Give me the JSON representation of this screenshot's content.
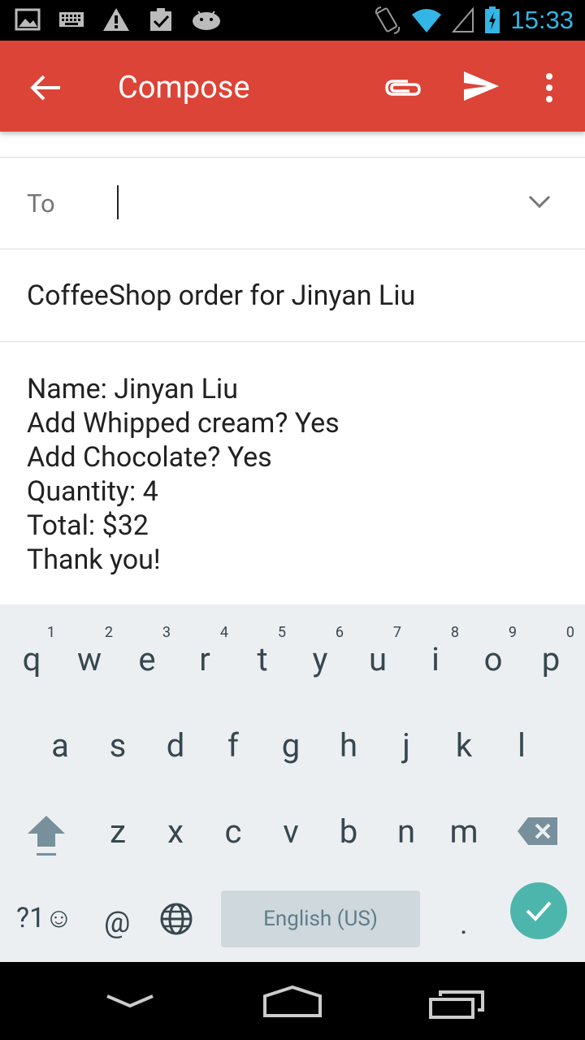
{
  "status_bar": {
    "time": "15:33",
    "left_icons": [
      "image-icon",
      "keyboard-icon",
      "warning-icon",
      "clipboard-check-icon",
      "android-icon"
    ],
    "right_icons": [
      "rotate-icon",
      "wifi-icon",
      "signal-icon",
      "battery-charging-icon"
    ]
  },
  "app_bar": {
    "title": "Compose",
    "color": "#db4437"
  },
  "compose": {
    "to_label": "To",
    "to_value": "",
    "subject": "CoffeeShop order for Jinyan Liu",
    "body_lines": [
      "Name: Jinyan Liu",
      "Add Whipped cream? Yes",
      "Add Chocolate? Yes",
      "Quantity: 4",
      "Total: $32",
      "Thank you!"
    ]
  },
  "keyboard": {
    "row1": [
      {
        "key": "q",
        "hint": "1"
      },
      {
        "key": "w",
        "hint": "2"
      },
      {
        "key": "e",
        "hint": "3"
      },
      {
        "key": "r",
        "hint": "4"
      },
      {
        "key": "t",
        "hint": "5"
      },
      {
        "key": "y",
        "hint": "6"
      },
      {
        "key": "u",
        "hint": "7"
      },
      {
        "key": "i",
        "hint": "8"
      },
      {
        "key": "o",
        "hint": "9"
      },
      {
        "key": "p",
        "hint": "0"
      }
    ],
    "row2": [
      "a",
      "s",
      "d",
      "f",
      "g",
      "h",
      "j",
      "k",
      "l"
    ],
    "row3": [
      "z",
      "x",
      "c",
      "v",
      "b",
      "n",
      "m"
    ],
    "symbols_label": "?1☺",
    "at_label": "@",
    "space_label": "English (US)",
    "period_label": ".",
    "accent_color": "#4db6ac"
  }
}
